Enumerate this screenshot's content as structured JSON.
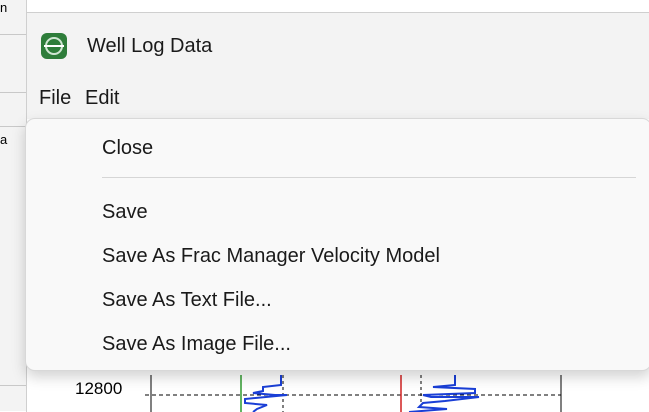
{
  "window": {
    "title": "Well Log Data",
    "icon": "well-log-app-icon"
  },
  "menubar": {
    "items": [
      {
        "label": "File"
      },
      {
        "label": "Edit"
      }
    ]
  },
  "file_menu": {
    "items": [
      {
        "label": "Close"
      },
      {
        "label": "Save"
      },
      {
        "label": "Save As Frac Manager Velocity Model"
      },
      {
        "label": "Save As Text File..."
      },
      {
        "label": "Save As Image File..."
      }
    ]
  },
  "plot": {
    "depth_tick_label": "12800"
  },
  "background": {
    "fragments": [
      "n",
      "a"
    ]
  }
}
